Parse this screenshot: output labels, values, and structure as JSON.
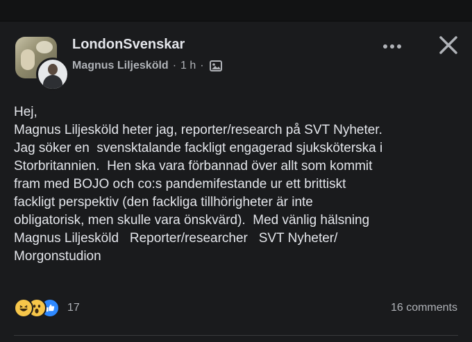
{
  "post": {
    "group_name": "LondonSvenskar",
    "author": "Magnus Liljeskold",
    "author_display": "Magnus Liljesköld",
    "separator": "·",
    "time": "1 h",
    "privacy_icon": "photo-icon",
    "body_lines": [
      "Hej,",
      "Magnus Liljesköld heter jag, reporter/research på SVT Nyheter.",
      "Jag söker en  svensktalande fackligt engagerad sjuksköterska i",
      "Storbritannien.  Hen ska vara förbannad över allt som kommit",
      "fram med BOJO och co:s pandemifestande ur ett brittiskt",
      "fackligt perspektiv (den fackliga tillhörigheter är inte",
      "obligatorisk, men skulle vara önskvärd).  Med vänlig hälsning",
      "Magnus Liljesköld   Reporter/researcher   SVT Nyheter/",
      "Morgonstudion"
    ],
    "reactions": {
      "icons": [
        "haha-icon",
        "wow-icon",
        "like-icon"
      ],
      "count": "17"
    },
    "comments": "16 comments"
  },
  "colors": {
    "background": "#1a1b1d",
    "text": "#e4e6eb",
    "secondary_text": "#b0b3b8",
    "like_blue": "#2e89ff",
    "emoji_yellow": "#f7c64a"
  }
}
